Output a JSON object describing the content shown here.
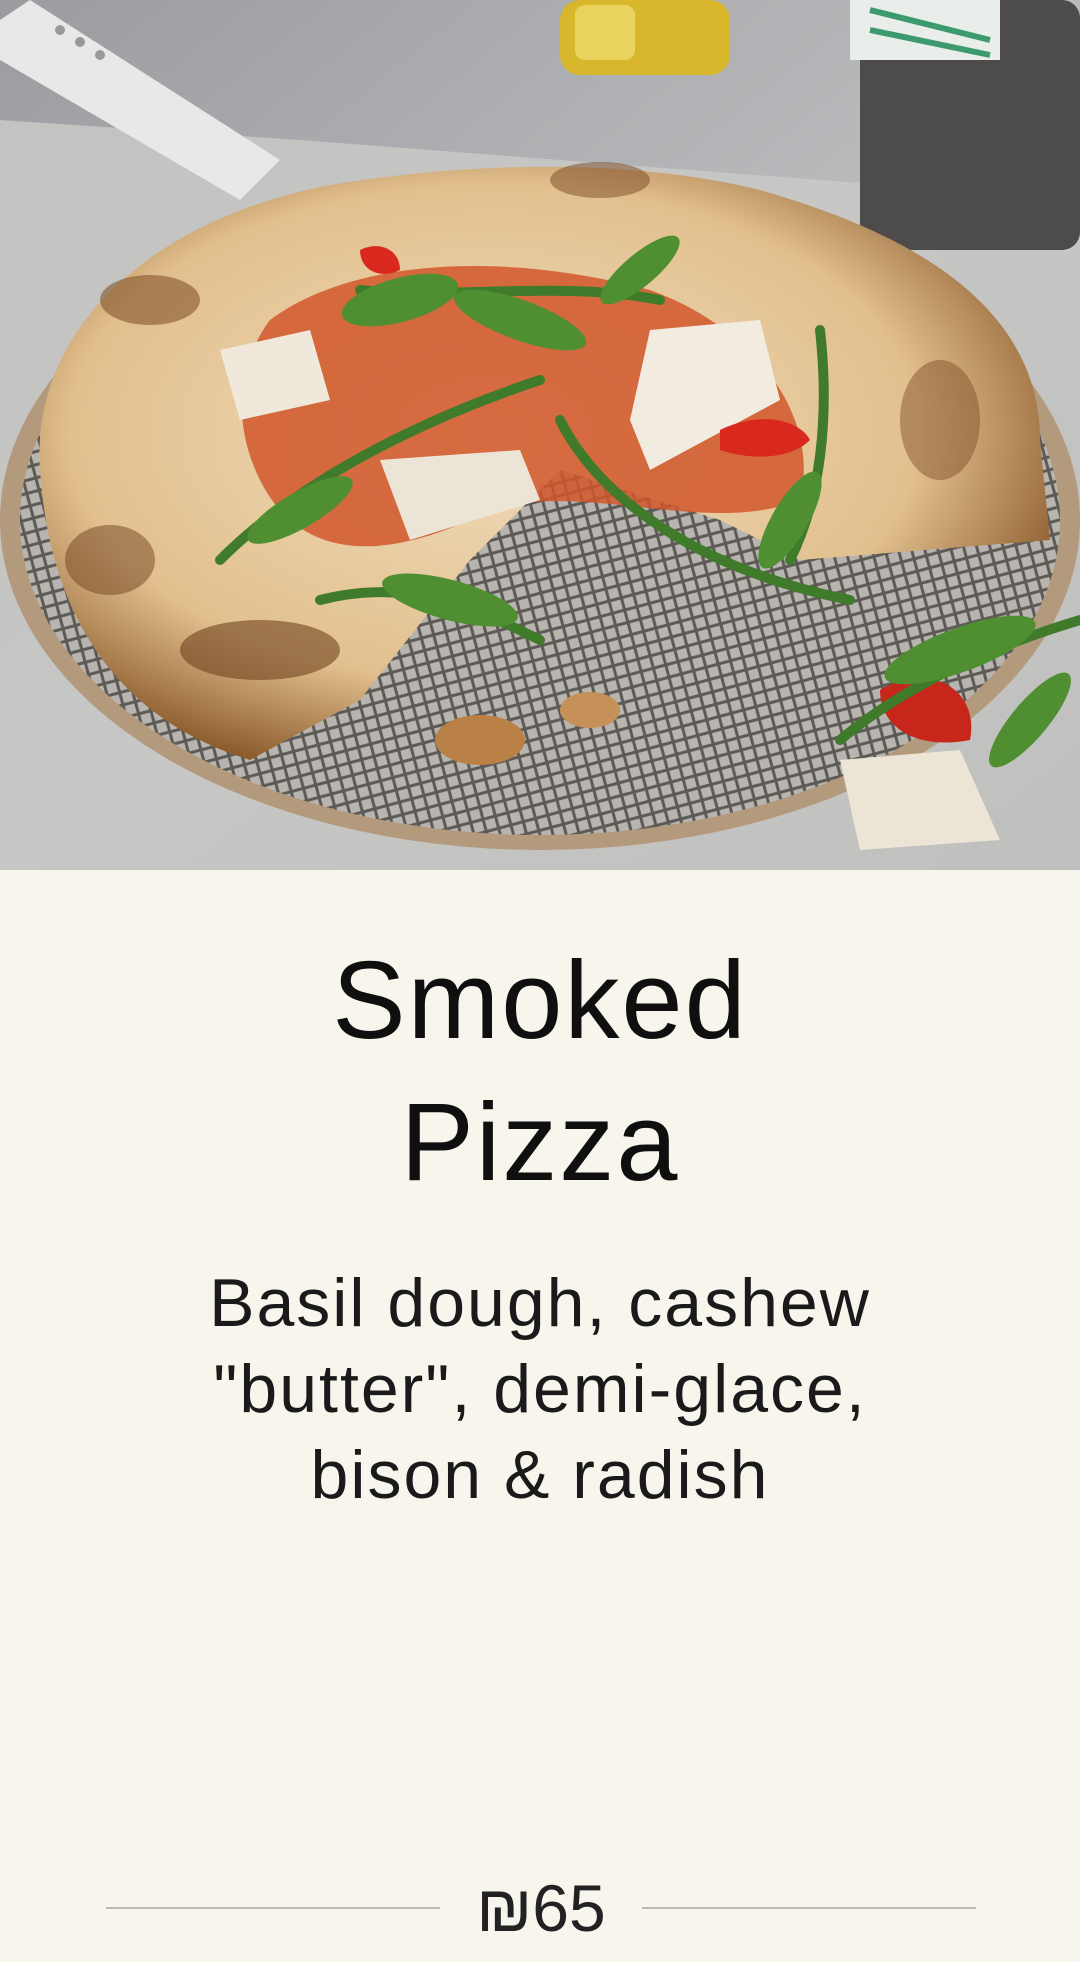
{
  "menu_item": {
    "title_line1": "Smoked",
    "title_line2": "Pizza",
    "description": "Basil dough, cashew \"butter\", demi-glace, bison & radish",
    "price": "₪65"
  },
  "colors": {
    "background": "#f8f5ec",
    "text": "#0f0f0f",
    "rule": "#bdbab1"
  }
}
